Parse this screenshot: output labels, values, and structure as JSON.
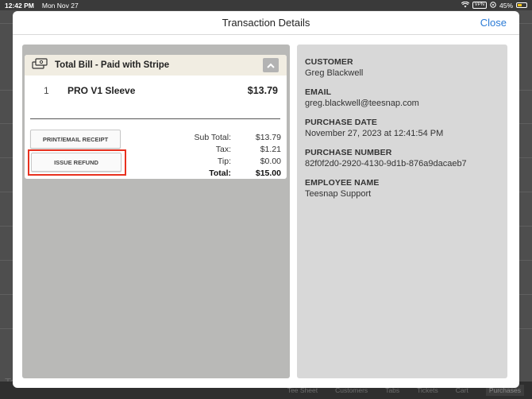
{
  "status_bar": {
    "time": "12:42 PM",
    "date": "Mon Nov 27",
    "vpn": "VPN",
    "battery": "45%"
  },
  "background": {
    "tabs": [
      "Tee Sheet",
      "Customers",
      "Tabs",
      "Tickets",
      "Cart",
      "Purchases"
    ],
    "left_fragment": "Te"
  },
  "modal": {
    "title": "Transaction Details",
    "close_label": "Close"
  },
  "bill": {
    "title": "Total Bill - Paid with Stripe",
    "item": {
      "qty": "1",
      "name": "PRO V1 Sleeve",
      "price": "$13.79"
    },
    "print_receipt_label": "PRINT/EMAIL RECEIPT",
    "refund_label": "ISSUE REFUND",
    "totals": [
      {
        "label": "Sub Total:",
        "value": "$13.79"
      },
      {
        "label": "Tax:",
        "value": "$1.21"
      },
      {
        "label": "Tip:",
        "value": "$0.00"
      },
      {
        "label": "Total:",
        "value": "$15.00"
      }
    ]
  },
  "details": {
    "customer_label": "CUSTOMER",
    "customer_value": "Greg  Blackwell",
    "email_label": "EMAIL",
    "email_value": "greg.blackwell@teesnap.com",
    "purchase_date_label": "PURCHASE DATE",
    "purchase_date_value": "November 27, 2023 at 12:41:54 PM",
    "purchase_number_label": "PURCHASE NUMBER",
    "purchase_number_value": "82f0f2d0-2920-4130-9d1b-876a9dacaeb7",
    "employee_label": "EMPLOYEE NAME",
    "employee_value": "Teesnap Support"
  },
  "colors": {
    "accent": "#2b7bd6",
    "highlight": "#e8311f",
    "bill_header_bg": "#f1ede2",
    "left_panel_bg": "#b9b9b7",
    "right_panel_bg": "#d8d8d8"
  }
}
